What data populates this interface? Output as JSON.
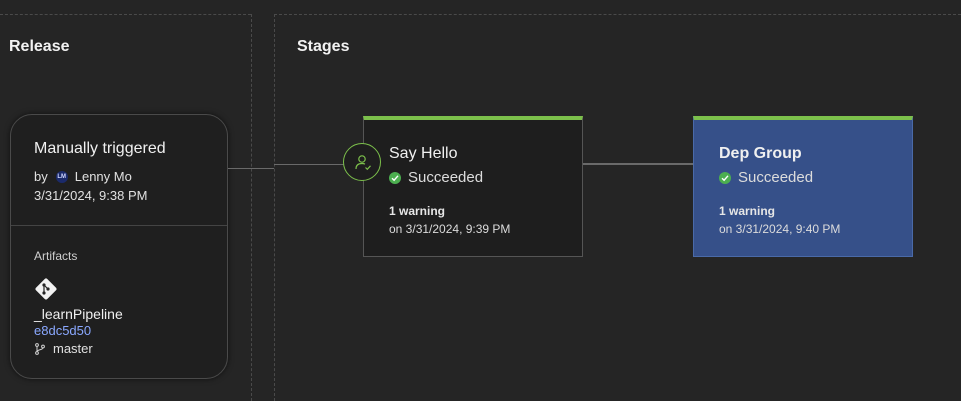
{
  "release": {
    "section_title": "Release",
    "trigger": "Manually triggered",
    "by_label": "by",
    "avatar_initials": "LM",
    "user": "Lenny Mo",
    "date": "3/31/2024, 9:38 PM",
    "artifacts_label": "Artifacts",
    "artifact_icon": "git-icon",
    "artifact_name": "_learnPipeline",
    "commit": "e8dc5d50",
    "branch_icon": "branch-icon",
    "branch": "master"
  },
  "stages": {
    "section_title": "Stages",
    "items": [
      {
        "name": "Say Hello",
        "status": "Succeeded",
        "warning": "1 warning",
        "on": "on 3/31/2024, 9:39 PM"
      },
      {
        "name": "Dep Group",
        "status": "Succeeded",
        "warning": "1 warning",
        "on": "on 3/31/2024, 9:40 PM"
      }
    ]
  },
  "colors": {
    "success_bar": "#7cc04b",
    "selected_stage_bg": "#365089",
    "commit_link": "#8aa8ff"
  }
}
